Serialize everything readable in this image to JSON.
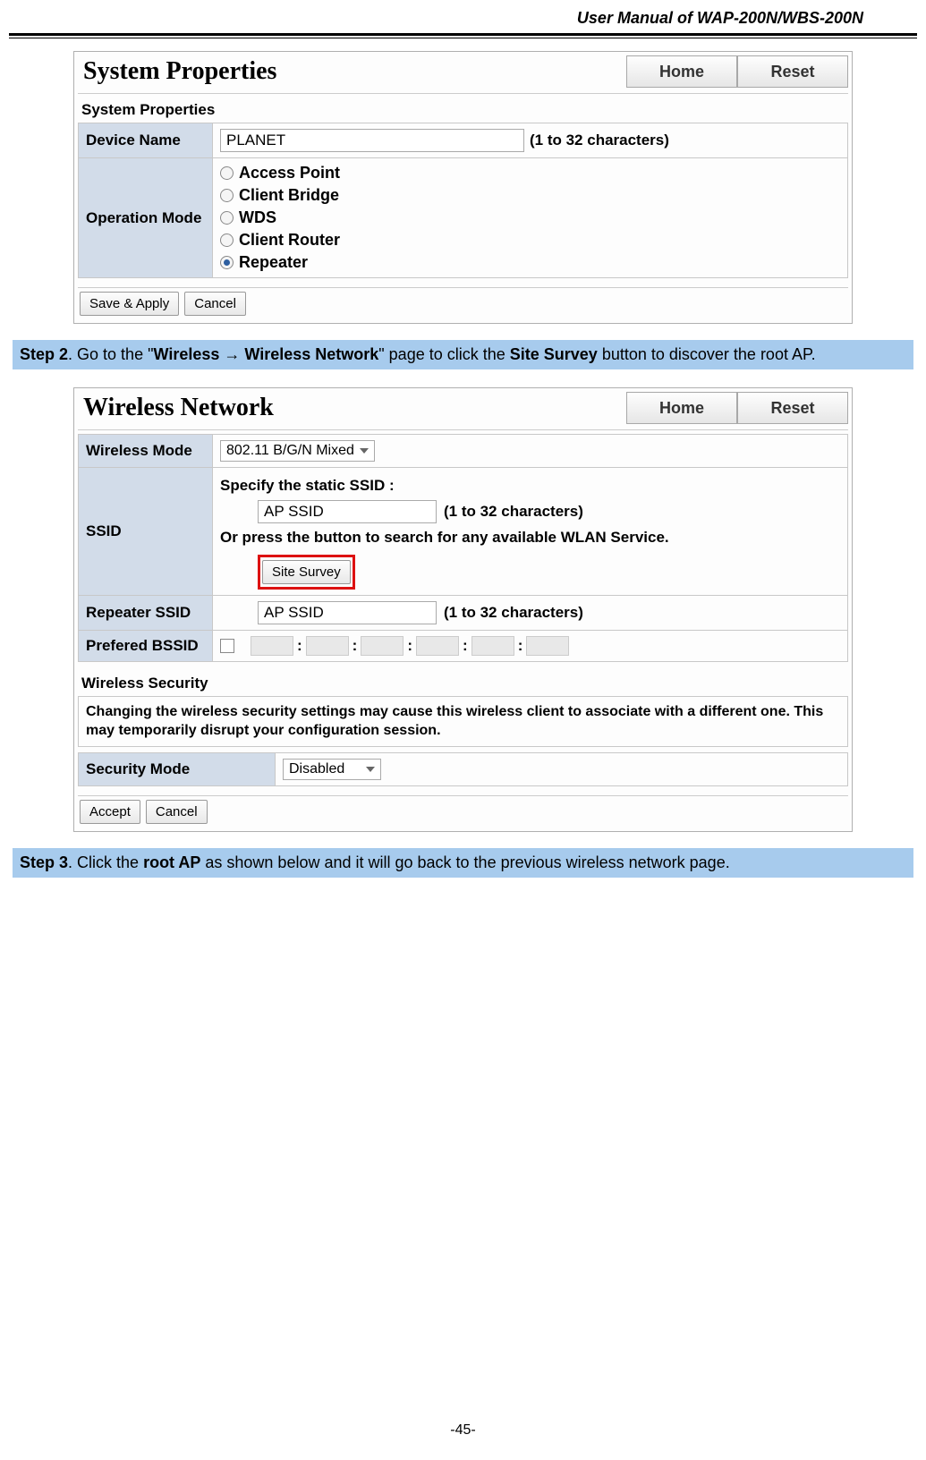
{
  "doc": {
    "header": "User Manual of WAP-200N/WBS-200N",
    "page_num": "-45-"
  },
  "panel1": {
    "title": "System Properties",
    "home": "Home",
    "reset": "Reset",
    "section": "System Properties",
    "device_name_label": "Device Name",
    "device_name_value": "PLANET",
    "char_hint": "(1 to 32 characters)",
    "op_mode_label": "Operation Mode",
    "modes": {
      "ap": "Access Point",
      "cb": "Client Bridge",
      "wds": "WDS",
      "cr": "Client Router",
      "rep": "Repeater"
    },
    "save": "Save & Apply",
    "cancel": "Cancel"
  },
  "step2": {
    "prefix": "Step 2",
    "t1": ". Go to the \"",
    "b1": "Wireless ",
    "arrow": "→",
    "b2": " Wireless Network",
    "t2": "\" page to click the ",
    "b3": "Site Survey",
    "t3": " button to discover the root AP."
  },
  "panel2": {
    "title": "Wireless Network",
    "home": "Home",
    "reset": "Reset",
    "wmode_label": "Wireless Mode",
    "wmode_value": "802.11 B/G/N Mixed",
    "ssid_label": "SSID",
    "ssid_static_text": "Specify the static SSID  :",
    "ssid_value": "AP SSID",
    "char_hint": "(1 to 32 characters)",
    "ssid_or_text": "Or press the button to search for any available WLAN Service.",
    "site_survey": "Site Survey",
    "repeater_label": "Repeater SSID",
    "repeater_value": "AP SSID",
    "bssid_label": "Prefered BSSID",
    "sec_section": "Wireless Security",
    "sec_warn": "Changing the wireless security settings may cause this wireless client to associate with a different one. This may temporarily disrupt your configuration session.",
    "sec_mode_label": "Security Mode",
    "sec_mode_value": "Disabled",
    "accept": "Accept",
    "cancel": "Cancel"
  },
  "step3": {
    "prefix": "Step 3",
    "t1": ". Click the ",
    "b1": "root AP",
    "t2": " as shown below and it will go back to the previous wireless network page."
  }
}
